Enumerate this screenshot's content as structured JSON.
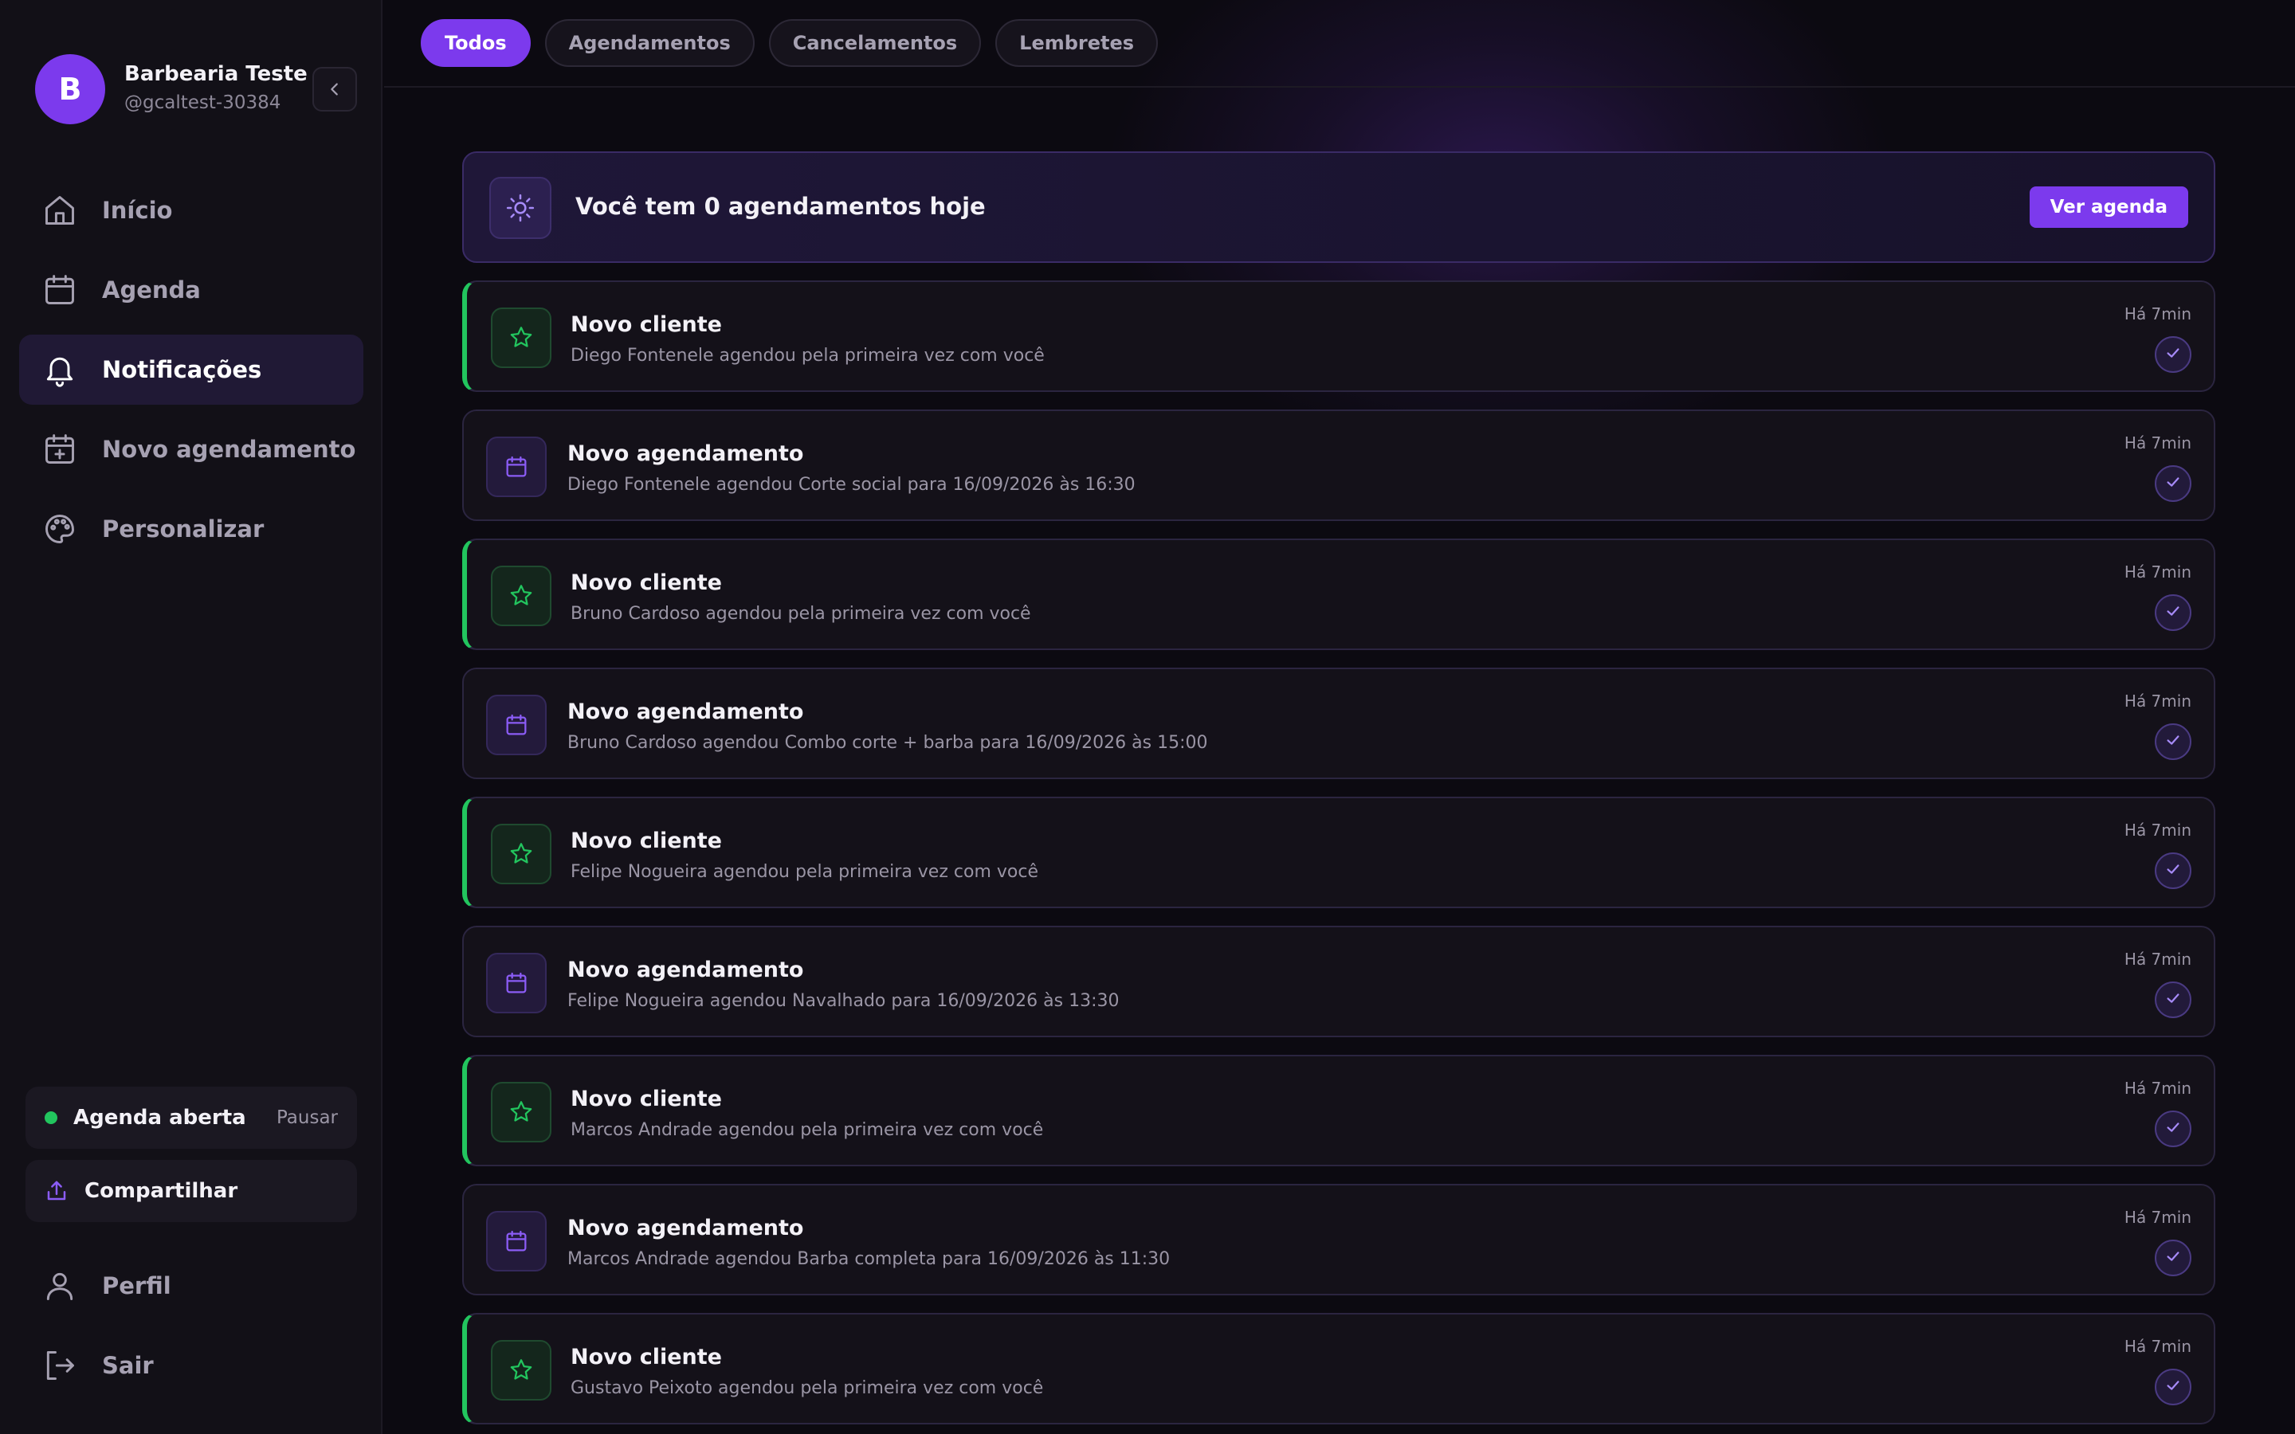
{
  "profile": {
    "avatar_letter": "B",
    "name": "Barbearia Teste",
    "handle": "@gcaltest-30384"
  },
  "sidebar": {
    "items": [
      {
        "label": "Início",
        "icon": "home-icon"
      },
      {
        "label": "Agenda",
        "icon": "calendar-icon"
      },
      {
        "label": "Notificações",
        "icon": "bell-icon",
        "active": true
      },
      {
        "label": "Novo agendamento",
        "icon": "calendar-plus-icon"
      },
      {
        "label": "Personalizar",
        "icon": "palette-icon"
      }
    ],
    "status": {
      "label": "Agenda aberta",
      "action": "Pausar",
      "color": "#22c55e"
    },
    "share": {
      "label": "Compartilhar"
    },
    "bottom": [
      {
        "label": "Perfil",
        "icon": "user-icon"
      },
      {
        "label": "Sair",
        "icon": "logout-icon"
      }
    ]
  },
  "tabs": [
    {
      "label": "Todos",
      "active": true
    },
    {
      "label": "Agendamentos"
    },
    {
      "label": "Cancelamentos"
    },
    {
      "label": "Lembretes"
    }
  ],
  "summary": {
    "text": "Você tem 0 agendamentos hoje",
    "button": "Ver agenda",
    "icon": "sun-icon"
  },
  "notifications": [
    {
      "type": "client",
      "title": "Novo cliente",
      "desc": "Diego Fontenele agendou pela primeira vez com você",
      "time": "Há 7min"
    },
    {
      "type": "booking",
      "title": "Novo agendamento",
      "desc": "Diego Fontenele agendou Corte social para 16/09/2026 às 16:30",
      "time": "Há 7min"
    },
    {
      "type": "client",
      "title": "Novo cliente",
      "desc": "Bruno Cardoso agendou pela primeira vez com você",
      "time": "Há 7min"
    },
    {
      "type": "booking",
      "title": "Novo agendamento",
      "desc": "Bruno Cardoso agendou Combo corte + barba para 16/09/2026 às 15:00",
      "time": "Há 7min"
    },
    {
      "type": "client",
      "title": "Novo cliente",
      "desc": "Felipe Nogueira agendou pela primeira vez com você",
      "time": "Há 7min"
    },
    {
      "type": "booking",
      "title": "Novo agendamento",
      "desc": "Felipe Nogueira agendou Navalhado para 16/09/2026 às 13:30",
      "time": "Há 7min"
    },
    {
      "type": "client",
      "title": "Novo cliente",
      "desc": "Marcos Andrade agendou pela primeira vez com você",
      "time": "Há 7min"
    },
    {
      "type": "booking",
      "title": "Novo agendamento",
      "desc": "Marcos Andrade agendou Barba completa para 16/09/2026 às 11:30",
      "time": "Há 7min"
    },
    {
      "type": "client",
      "title": "Novo cliente",
      "desc": "Gustavo Peixoto agendou pela primeira vez com você",
      "time": "Há 7min"
    }
  ],
  "colors": {
    "accent": "#7c3aed",
    "success": "#22c55e",
    "background": "#0c0a11",
    "sidebar": "#121017"
  }
}
